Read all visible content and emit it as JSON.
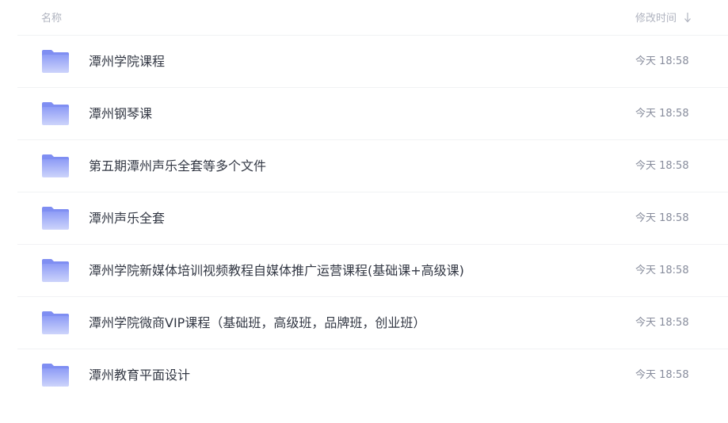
{
  "header": {
    "name_label": "名称",
    "modified_label": "修改时间",
    "sort_icon": "arrow-down-icon"
  },
  "files": [
    {
      "name": "潭州学院课程",
      "time": "今天 18:58",
      "icon": "folder-icon"
    },
    {
      "name": "潭州钢琴课",
      "time": "今天 18:58",
      "icon": "folder-icon"
    },
    {
      "name": "第五期潭州声乐全套等多个文件",
      "time": "今天 18:58",
      "icon": "folder-icon"
    },
    {
      "name": "潭州声乐全套",
      "time": "今天 18:58",
      "icon": "folder-icon"
    },
    {
      "name": "潭州学院新媒体培训视频教程自媒体推广运营课程(基础课+高级课)",
      "time": "今天 18:58",
      "icon": "folder-icon"
    },
    {
      "name": "潭州学院微商VIP课程（基础班，高级班，品牌班，创业班）",
      "time": "今天 18:58",
      "icon": "folder-icon"
    },
    {
      "name": "潭州教育平面设计",
      "time": "今天 18:58",
      "icon": "folder-icon"
    }
  ],
  "colors": {
    "folder_top": "#8e9cf6",
    "folder_bottom": "#c9d1fb",
    "folder_back": "#7e8ef2"
  }
}
